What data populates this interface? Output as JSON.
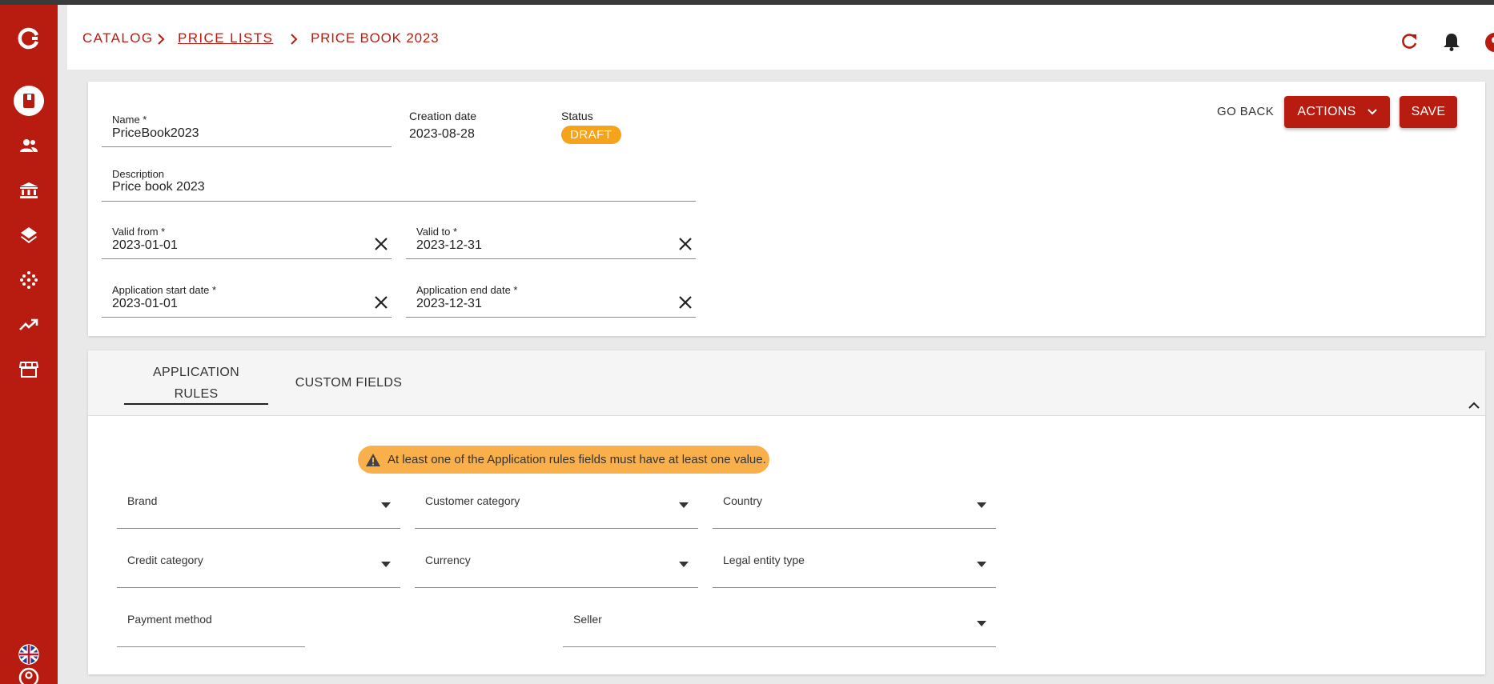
{
  "breadcrumb": {
    "items": [
      "CATALOG",
      "PRICE LISTS",
      "PRICE BOOK 2023"
    ]
  },
  "form": {
    "name": {
      "label": "Name *",
      "value": "PriceBook2023"
    },
    "creation_date": {
      "label": "Creation date",
      "value": "2023-08-28"
    },
    "status": {
      "label": "Status",
      "value": "DRAFT"
    },
    "description": {
      "label": "Description",
      "value": "Price book 2023"
    },
    "valid_from": {
      "label": "Valid from *",
      "value": "2023-01-01"
    },
    "valid_to": {
      "label": "Valid to *",
      "value": "2023-12-31"
    },
    "app_start": {
      "label": "Application start date *",
      "value": "2023-01-01"
    },
    "app_end": {
      "label": "Application end date *",
      "value": "2023-12-31"
    }
  },
  "actions": {
    "go_back": "GO BACK",
    "actions": "ACTIONS",
    "save": "SAVE"
  },
  "tabs": {
    "application_rules_line1": "APPLICATION",
    "application_rules_line2": "RULES",
    "custom_fields": "CUSTOM FIELDS"
  },
  "rules": {
    "warning": "At least one of the Application rules fields must have at least one value.",
    "fields": {
      "brand": "Brand",
      "customer_category": "Customer category",
      "country": "Country",
      "credit_category": "Credit category",
      "currency": "Currency",
      "legal_entity_type": "Legal entity type",
      "payment_method": "Payment method",
      "seller": "Seller"
    }
  },
  "colors": {
    "brand_red": "#b81c10",
    "status_orange": "#f7a21b",
    "warning_orange": "#f9b04a"
  },
  "icons": {
    "sidebar": [
      "app-logo-icon",
      "catalog-book-icon",
      "people-icon",
      "bank-icon",
      "layers-icon",
      "dots-grid-icon",
      "trending-up-icon",
      "storefront-icon",
      "uk-flag-icon",
      "help-icon"
    ],
    "header": [
      "refresh-icon",
      "bell-icon",
      "account-icon"
    ]
  }
}
